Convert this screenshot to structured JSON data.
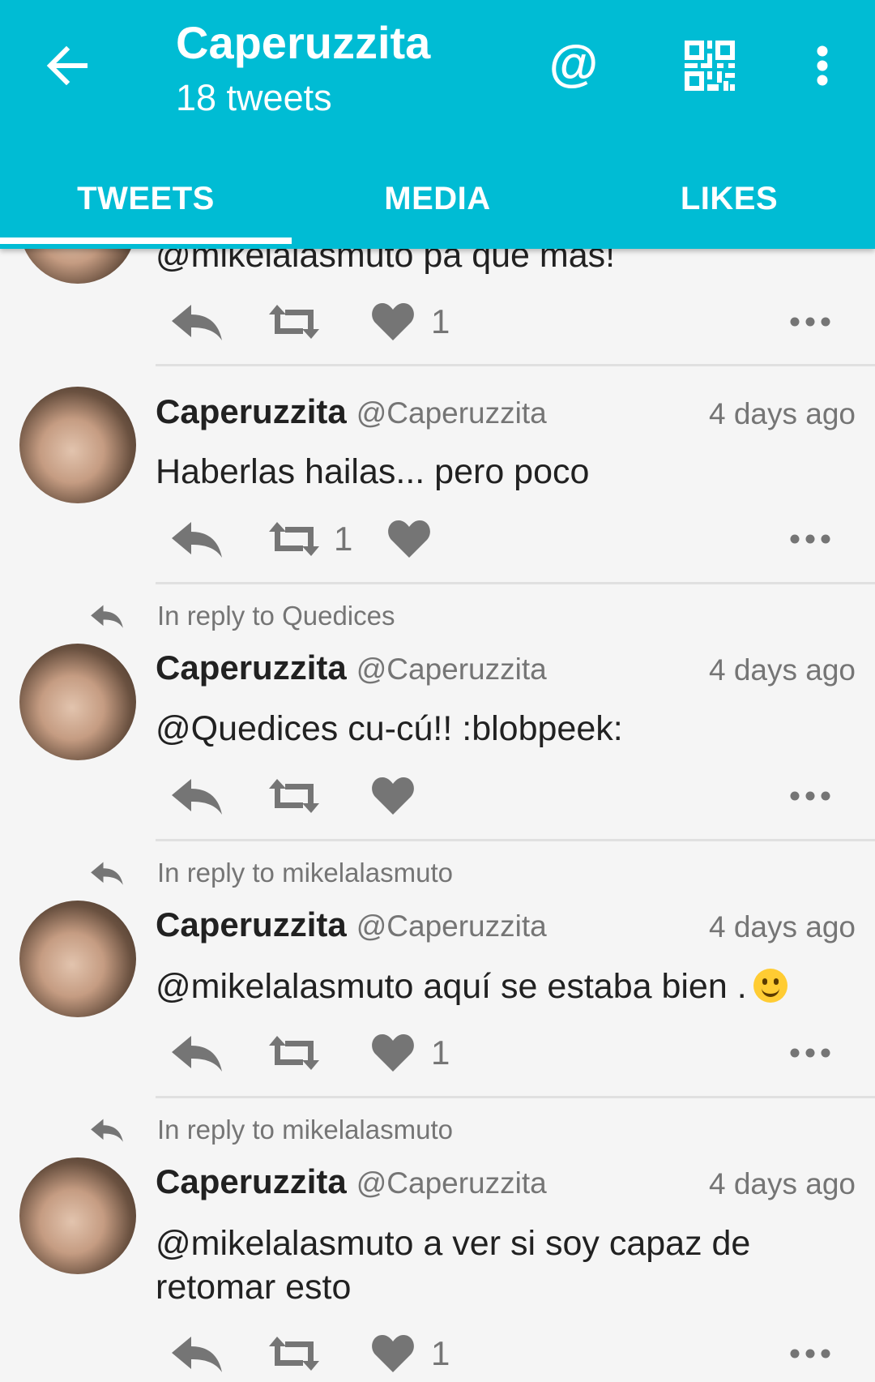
{
  "header": {
    "title": "Caperuzzita",
    "subtitle": "18 tweets",
    "at_label": "@"
  },
  "tabs": [
    {
      "label": "TWEETS",
      "active": true
    },
    {
      "label": "MEDIA",
      "active": false
    },
    {
      "label": "LIKES",
      "active": false
    }
  ],
  "colors": {
    "accent": "#00bcd4",
    "text_primary": "#212121",
    "text_secondary": "#757575",
    "icon": "#757575"
  },
  "tweets": [
    {
      "reply_to": "",
      "author_name": "",
      "author_handle": "",
      "time": "",
      "text": "@mikelalasmuto pa que mas!",
      "retweets": "",
      "likes": "1"
    },
    {
      "reply_to": "",
      "author_name": "Caperuzzita",
      "author_handle": "@Caperuzzita",
      "time": "4 days ago",
      "text": "Haberlas hailas... pero poco",
      "retweets": "1",
      "likes": ""
    },
    {
      "reply_to": "In reply to Quedices",
      "author_name": "Caperuzzita",
      "author_handle": "@Caperuzzita",
      "time": "4 days ago",
      "text": "@Quedices cu-cú!! :blobpeek:",
      "retweets": "",
      "likes": ""
    },
    {
      "reply_to": "In reply to mikelalasmuto",
      "author_name": "Caperuzzita",
      "author_handle": "@Caperuzzita",
      "time": "4 days ago",
      "text": "@mikelalasmuto aquí se estaba bien .",
      "emoji": "slightly-smiling-face",
      "retweets": "",
      "likes": "1"
    },
    {
      "reply_to": "In reply to mikelalasmuto",
      "author_name": "Caperuzzita",
      "author_handle": "@Caperuzzita",
      "time": "4 days ago",
      "text": "@mikelalasmuto a ver si soy capaz de retomar esto",
      "retweets": "",
      "likes": "1"
    }
  ],
  "icons": {
    "back": "arrow-left-icon",
    "mention": "at-icon",
    "qr": "qr-code-icon",
    "more": "more-vertical-icon",
    "reply": "reply-icon",
    "retweet": "retweet-icon",
    "like": "heart-icon",
    "overflow": "more-horizontal-icon"
  }
}
